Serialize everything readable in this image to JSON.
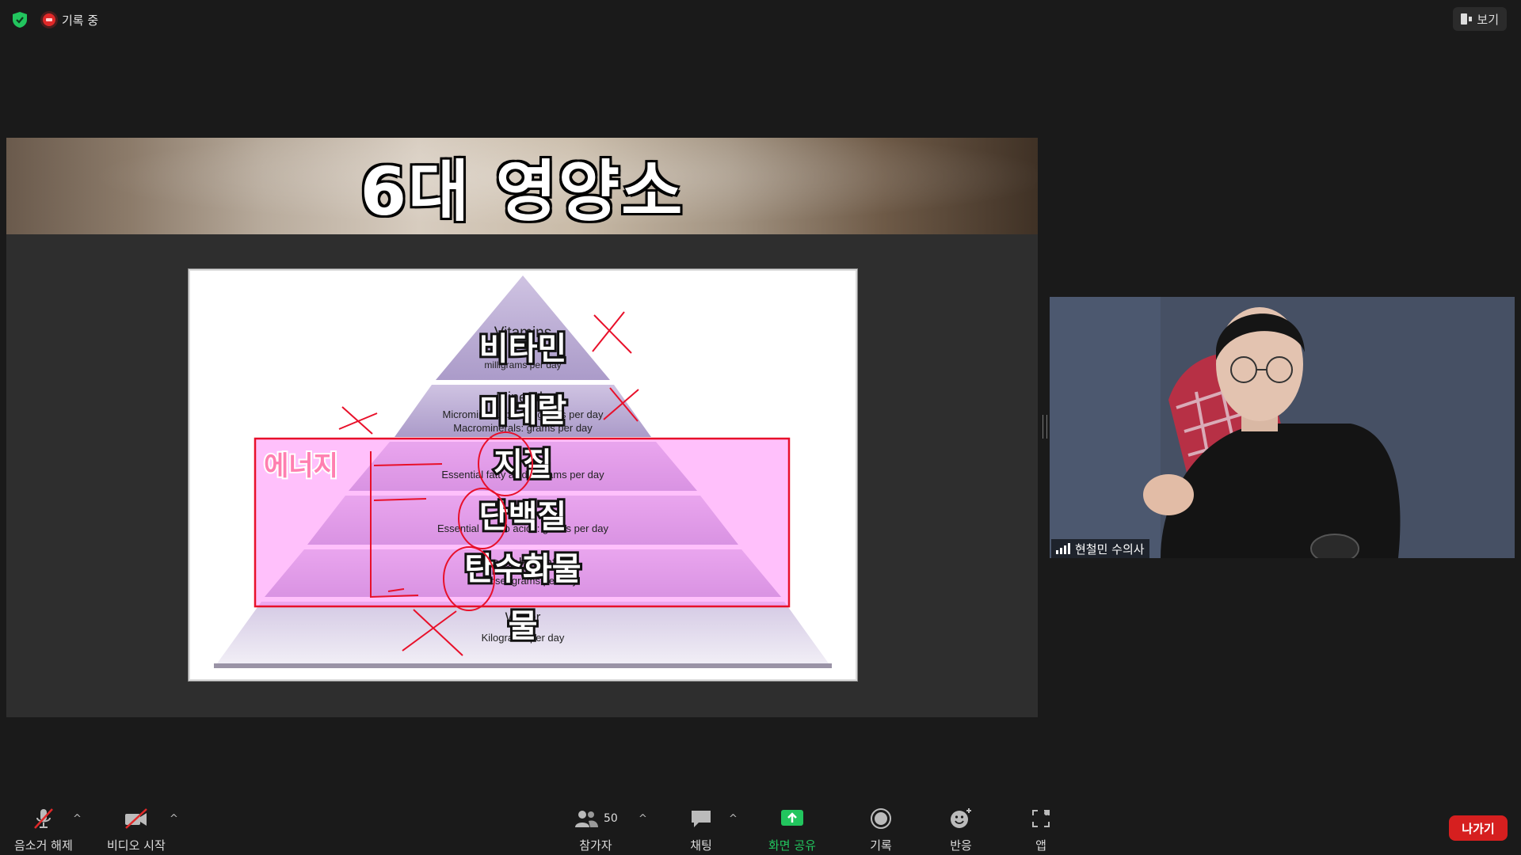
{
  "status": {
    "recording_label": "기록 중"
  },
  "view_button": {
    "label": "보기"
  },
  "slide": {
    "title": "6대 영양소",
    "pyramid": {
      "levels": [
        {
          "english": "Vitamins",
          "english_sub": "milligrams per day",
          "korean": "비타민"
        },
        {
          "english": "Minerals",
          "english_sub": "Microminerals: micrograms per day",
          "english_sub2": "Macrominerals: grams per day",
          "korean": "미네랄"
        },
        {
          "english": "",
          "english_sub": "Essential fatty acids: grams per day",
          "korean": "지질"
        },
        {
          "english": "",
          "english_sub": "Essential amino acids: grams per day",
          "korean": "단백질"
        },
        {
          "english": "Carbohydrate",
          "english_sub": "Glucose: grams per day",
          "korean": "탄수화물"
        },
        {
          "english": "Water",
          "english_sub": "Kilograms per day",
          "korean": "물"
        }
      ],
      "energy_label": "에너지"
    }
  },
  "participant": {
    "name": "현철민 수의사"
  },
  "toolbar": {
    "mute_label": "음소거 해제",
    "video_label": "비디오 시작",
    "participants_label": "참가자",
    "participants_count": "50",
    "chat_label": "채팅",
    "share_label": "화면 공유",
    "record_label": "기록",
    "reactions_label": "반응",
    "apps_label": "앱",
    "leave_label": "나가기"
  },
  "colors": {
    "share_green": "#22c55e",
    "leave_red": "#d61f1f",
    "annotation_red": "#e8102a",
    "energy_box": "#f7a8f4"
  }
}
